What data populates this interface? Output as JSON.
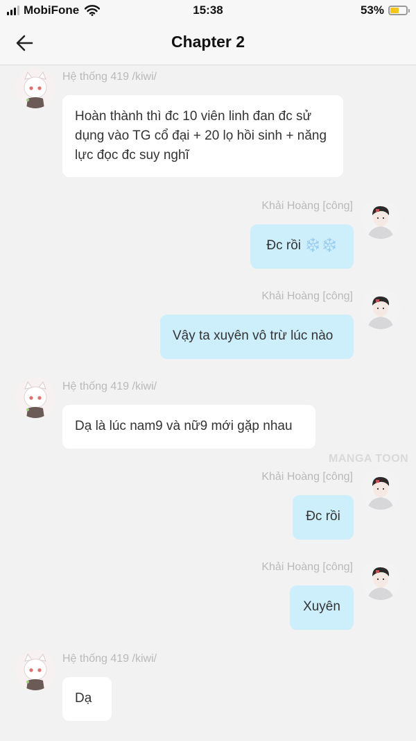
{
  "status_bar": {
    "carrier": "MobiFone",
    "time": "15:38",
    "battery_percent": "53%",
    "battery_level": 0.53,
    "icons": [
      "signal-icon",
      "wifi-icon",
      "battery-icon"
    ]
  },
  "nav": {
    "title": "Chapter 2",
    "back_icon": "arrow-left-icon"
  },
  "messages": [
    {
      "side": "left",
      "sender": "Hệ thống 419 /kiwi/",
      "text": "Hoàn thành thì đc 10 viên linh đan đc sử dụng vào TG cổ đại + 20 lọ hồi sinh + năng lực đọc đc suy nghĩ"
    },
    {
      "side": "right",
      "sender": "Khải Hoàng [công]",
      "text": "Đc rồi ❄️❄️"
    },
    {
      "side": "right",
      "sender": "Khải Hoàng [công]",
      "text": "Vậy ta xuyên vô trừ lúc nào"
    },
    {
      "side": "left",
      "sender": "Hệ thống 419 /kiwi/",
      "text": "Dạ là lúc nam9 và nữ9 mới gặp nhau"
    },
    {
      "side": "right",
      "sender": "Khải Hoàng [công]",
      "text": "Đc rồi"
    },
    {
      "side": "right",
      "sender": "Khải Hoàng [công]",
      "text": "Xuyên"
    },
    {
      "side": "left",
      "sender": "Hệ thống 419 /kiwi/",
      "text": "Dạ"
    }
  ],
  "watermark": "MANGA TOON",
  "colors": {
    "background": "#f2f2f2",
    "bubble_left": "#ffffff",
    "bubble_right": "#cdeefb",
    "sender_text": "#b9b9b9",
    "battery": "#f5c518"
  }
}
